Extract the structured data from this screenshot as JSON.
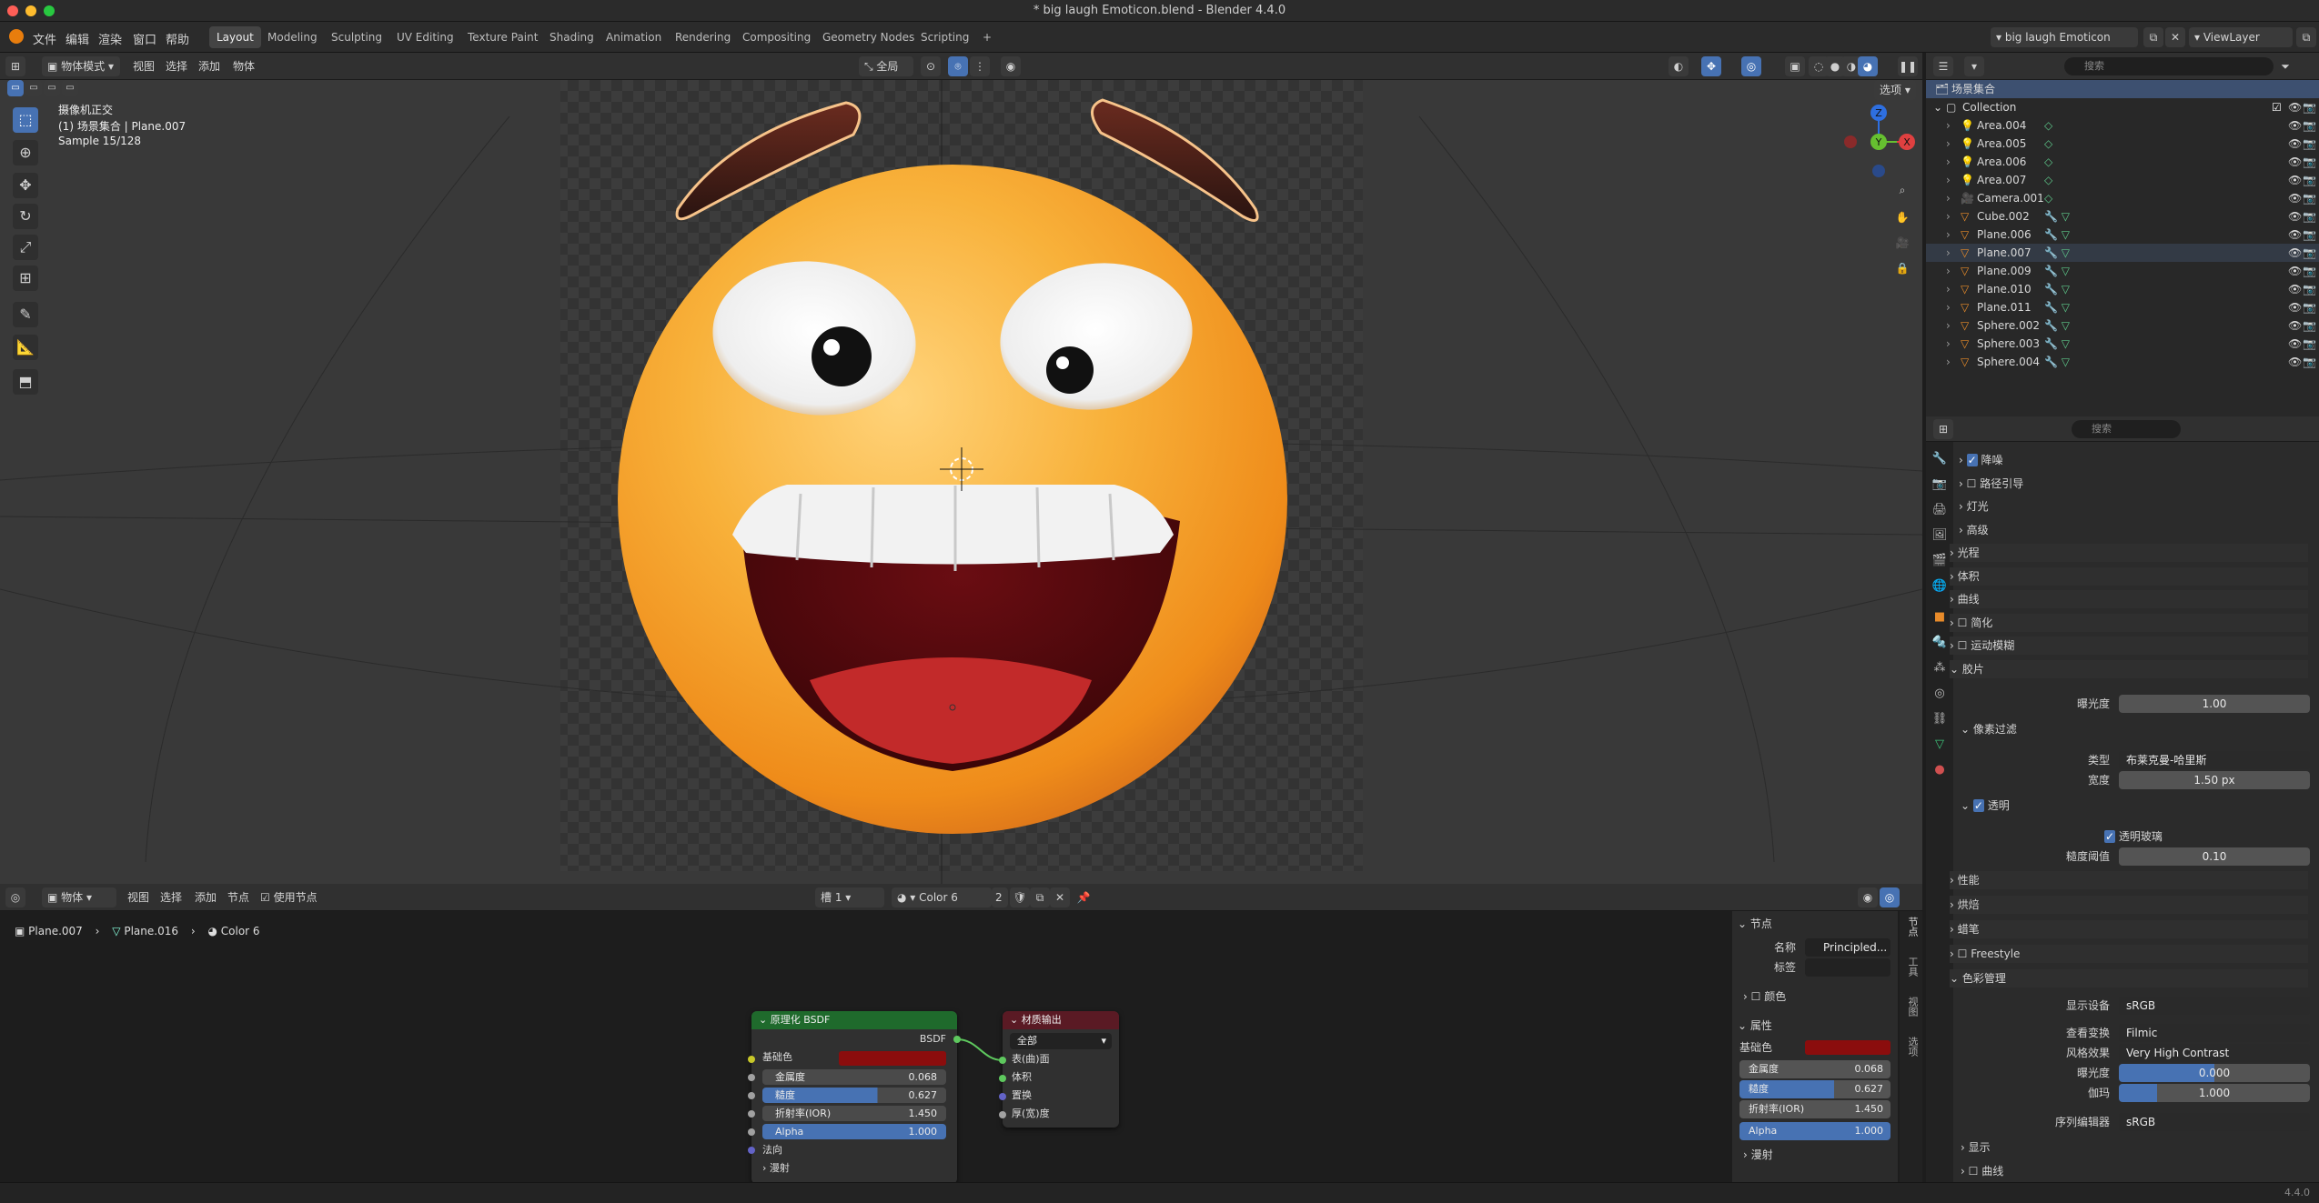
{
  "window": {
    "title": "* big laugh Emoticon.blend - Blender 4.4.0"
  },
  "menu": [
    "文件",
    "编辑",
    "渲染",
    "窗口",
    "帮助"
  ],
  "workspaces": [
    "Layout",
    "Modeling",
    "Sculpting",
    "UV Editing",
    "Texture Paint",
    "Shading",
    "Animation",
    "Rendering",
    "Compositing",
    "Geometry Nodes",
    "Scripting"
  ],
  "active_workspace": "Layout",
  "top_right": {
    "scene": "big laugh Emoticon",
    "view_layer": "ViewLayer"
  },
  "viewport_header": {
    "mode": "物体模式",
    "menus": [
      "视图",
      "选择",
      "添加",
      "物体"
    ],
    "transform": "全局",
    "options": "选项",
    "search_placeholder": "搜索"
  },
  "viewport_info": {
    "line1": "摄像机正交",
    "line2": "(1) 场景集合 | Plane.007",
    "line3": "Sample 15/128"
  },
  "outliner": {
    "root": "场景集合",
    "collection": "Collection",
    "items": [
      "Area.004",
      "Area.005",
      "Area.006",
      "Area.007",
      "Camera.001",
      "Cube.002",
      "Plane.006",
      "Plane.007",
      "Plane.009",
      "Plane.010",
      "Plane.011",
      "Sphere.002",
      "Sphere.003",
      "Sphere.004"
    ],
    "item_types": [
      "light",
      "light",
      "light",
      "light",
      "camera",
      "mesh",
      "mesh",
      "mesh",
      "mesh",
      "mesh",
      "mesh",
      "mesh",
      "mesh",
      "mesh"
    ]
  },
  "properties": {
    "search_placeholder": "搜索",
    "rows": [
      {
        "label": "降噪",
        "kind": "sub-check",
        "checked": true
      },
      {
        "label": "路径引导",
        "kind": "sub-check",
        "checked": false
      },
      {
        "label": "灯光",
        "kind": "sub"
      },
      {
        "label": "高级",
        "kind": "sub"
      },
      {
        "label": "光程",
        "kind": "panel"
      },
      {
        "label": "体积",
        "kind": "panel"
      },
      {
        "label": "曲线",
        "kind": "panel"
      },
      {
        "label": "简化",
        "kind": "panel-check"
      },
      {
        "label": "运动模糊",
        "kind": "panel-check"
      },
      {
        "label": "胶片",
        "kind": "panel-open"
      }
    ],
    "film": {
      "exposure_label": "曝光度",
      "exposure": "1.00",
      "pixel_filter": "像素过滤",
      "type_label": "类型",
      "type": "布莱克曼-哈里斯",
      "width_label": "宽度",
      "width": "1.50 px",
      "transparent": "透明",
      "transparent_glass": "透明玻璃",
      "roughness_threshold_label": "糙度阈值",
      "roughness_threshold": "0.10"
    },
    "panels2": [
      "性能",
      "烘焙",
      "蜡笔",
      "Freestyle"
    ],
    "color_management": {
      "title": "色彩管理",
      "display_device_label": "显示设备",
      "display_device": "sRGB",
      "view_transform_label": "查看变换",
      "view_transform": "Filmic",
      "look_label": "风格效果",
      "look": "Very High Contrast",
      "exposure_label": "曝光度",
      "exposure": "0.000",
      "gamma_label": "伽玛",
      "gamma": "1.000",
      "sequencer_label": "序列编辑器",
      "sequencer": "sRGB",
      "display": "显示",
      "curves": "曲线"
    }
  },
  "node_editor": {
    "header": {
      "type": "物体",
      "menus": [
        "视图",
        "选择",
        "添加",
        "节点"
      ],
      "use_nodes": "使用节点",
      "slot": "槽 1",
      "material": "Color 6",
      "users": "2"
    },
    "breadcrumb": [
      "Plane.007",
      "Plane.016",
      "Color 6"
    ],
    "bsdf": {
      "title": "原理化 BSDF",
      "output": "BSDF",
      "base_color_label": "基础色",
      "base_color": "#8b0d0d",
      "metallic_label": "金属度",
      "metallic": "0.068",
      "roughness_label": "糙度",
      "roughness": "0.627",
      "ior_label": "折射率(IOR)",
      "ior": "1.450",
      "alpha_label": "Alpha",
      "alpha": "1.000",
      "normal_label": "法向",
      "diffuse_label": "漫射"
    },
    "output_node": {
      "title": "材质输出",
      "target": "全部",
      "surface": "表(曲)面",
      "volume": "体积",
      "displacement": "置换",
      "thickness": "厚(宽)度"
    },
    "sidebar": {
      "node_panel": "节点",
      "name_label": "名称",
      "name": "Principled...",
      "label_label": "标签",
      "color": "颜色",
      "props_panel": "属性",
      "base_color_label": "基础色",
      "metallic_label": "金属度",
      "metallic": "0.068",
      "roughness_label": "糙度",
      "roughness": "0.627",
      "ior_label": "折射率(IOR)",
      "ior": "1.450",
      "alpha_label": "Alpha",
      "alpha": "1.000",
      "diffuse_label": "漫射",
      "tabs": [
        "节点",
        "工具",
        "视图",
        "选项"
      ]
    }
  },
  "status": {
    "version": "4.4.0"
  },
  "colors": {
    "accent": "#4772b3",
    "bsdf_header": "#1f6a2c",
    "output_header": "#5a1a24",
    "emoji": "#f5a623"
  }
}
